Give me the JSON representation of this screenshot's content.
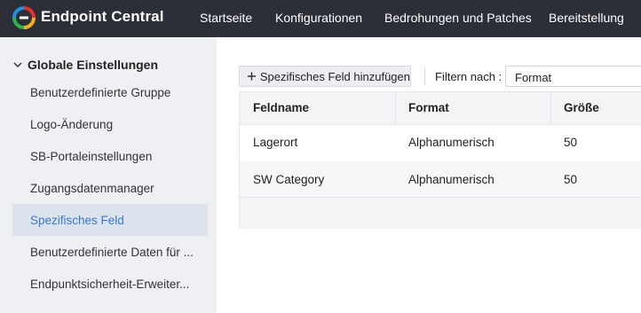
{
  "header": {
    "brand": "Endpoint Central",
    "nav": [
      "Startseite",
      "Konfigurationen",
      "Bedrohungen und Patches",
      "Bereitstellung"
    ]
  },
  "sidebar": {
    "group_label": "Globale Einstellungen",
    "items": [
      {
        "label": "Benutzerdefinierte Gruppe"
      },
      {
        "label": "Logo-Änderung"
      },
      {
        "label": "SB-Portaleinstellungen"
      },
      {
        "label": "Zugangsdatenmanager"
      },
      {
        "label": "Spezifisches Feld",
        "active": true
      },
      {
        "label": "Benutzerdefinierte Daten für ..."
      },
      {
        "label": "Endpunktsicherheit-Erweiter..."
      }
    ]
  },
  "toolbar": {
    "add_label": "Spezifisches Feld hinzufügen",
    "filter_label": "Filtern nach :",
    "filter_value": "Format"
  },
  "table": {
    "columns": [
      "Feldname",
      "Format",
      "Größe"
    ],
    "rows": [
      [
        "Lagerort",
        "Alphanumerisch",
        "50"
      ],
      [
        "SW Category",
        "Alphanumerisch",
        "50"
      ]
    ]
  },
  "colors": {
    "topbar": "#2b2f38",
    "sidebar_bg": "#eef0f3",
    "active_item_bg": "#dde3ec",
    "active_item_text": "#3a78d1",
    "logo_red": "#e5322d",
    "logo_blue": "#1f8fe0",
    "logo_yellow": "#f6b21a",
    "logo_green": "#2eb24b"
  },
  "icons": [
    "endpoint-central-logo-icon",
    "chevron-down-icon",
    "plus-icon"
  ]
}
